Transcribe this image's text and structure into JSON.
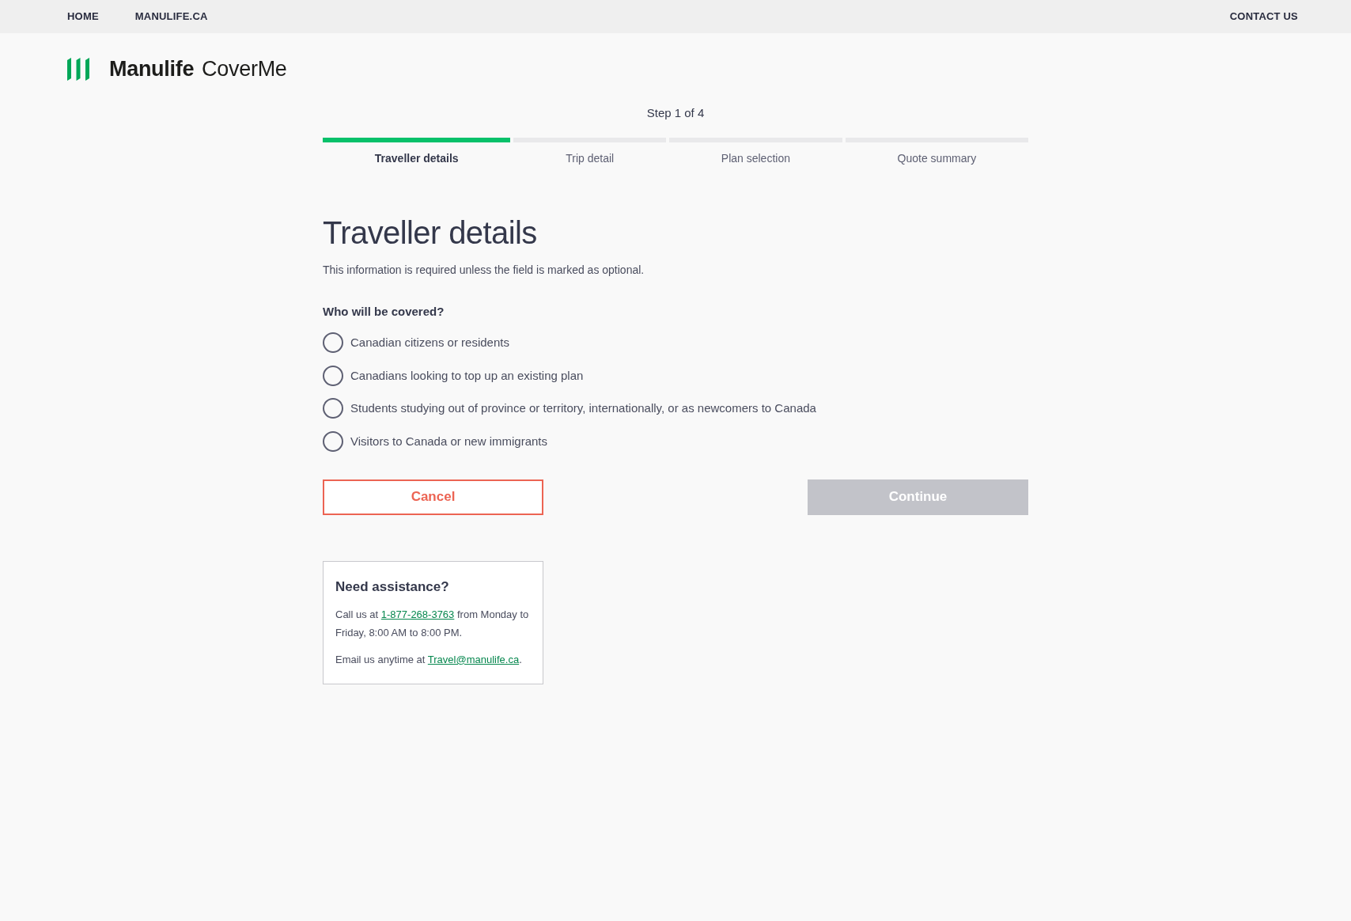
{
  "top_nav": {
    "links": [
      {
        "label": "HOME"
      },
      {
        "label": "MANULIFE.CA"
      }
    ],
    "contact_link": "CONTACT US"
  },
  "brand": {
    "name": "Manulife",
    "product": "CoverMe"
  },
  "progress": {
    "caption": "Step 1 of 4",
    "steps": [
      {
        "label": "Traveller details",
        "selected": true
      },
      {
        "label": "Trip detail",
        "selected": false
      },
      {
        "label": "Plan selection",
        "selected": false
      },
      {
        "label": "Quote summary",
        "selected": false
      }
    ]
  },
  "form": {
    "title": "Traveller details",
    "note": "This information is required unless the field is marked as optional.",
    "question": "Who will be covered?",
    "options": [
      {
        "label": "Canadian citizens or residents",
        "selected": false
      },
      {
        "label": "Canadians looking to top up an existing plan",
        "selected": false
      },
      {
        "label": "Students studying out of province or territory, internationally, or as newcomers to Canada",
        "selected": false
      },
      {
        "label": "Visitors to Canada or new immigrants",
        "selected": false
      }
    ]
  },
  "actions": [
    {
      "kind": "outline",
      "label": "Cancel",
      "disabled": false
    },
    {
      "kind": "filled",
      "label": "Continue",
      "disabled": true
    }
  ],
  "assistance": {
    "title": "Need assistance?",
    "paragraphs": [
      {
        "before": "Call us at ",
        "link": "1-877-268-3763",
        "after": " from Monday to Friday, 8:00 AM to 8:00 PM."
      },
      {
        "before": "Email us anytime at ",
        "link": "Travel@manulife.ca",
        "after": "."
      }
    ]
  }
}
